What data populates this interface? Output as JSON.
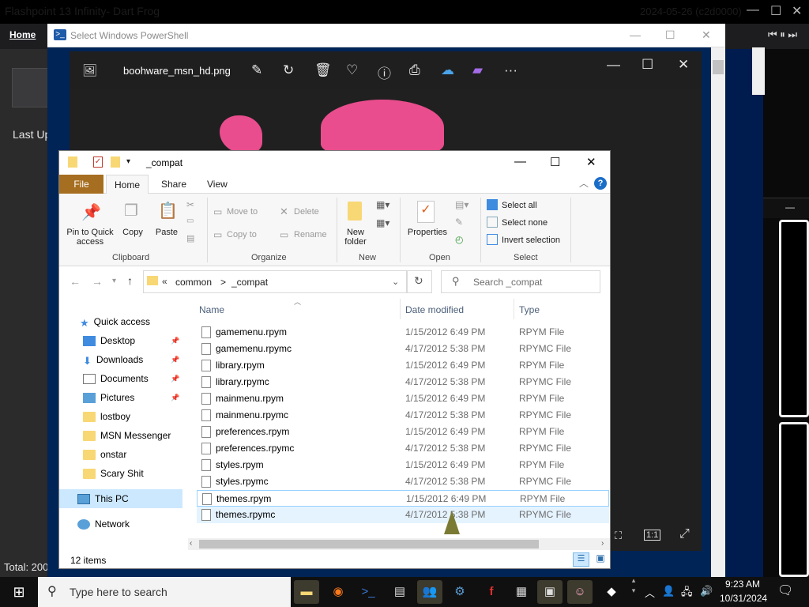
{
  "flashpoint": {
    "title": "Flashpoint 13 Infinity- Dart Frog",
    "date_build": "2024-05-26 (c2d0000)",
    "nav_home": "Home",
    "last_updated": "Last Up",
    "total": "Total: 200"
  },
  "powershell": {
    "title": "Select Windows PowerShell"
  },
  "photos": {
    "filename": "boohware_msn_hd.png",
    "zoom_label": "1:1"
  },
  "explorer": {
    "title": "_compat",
    "tabs": {
      "file": "File",
      "home": "Home",
      "share": "Share",
      "view": "View"
    },
    "ribbon": {
      "pin": "Pin to Quick access",
      "copy": "Copy",
      "paste": "Paste",
      "move_to": "Move to",
      "copy_to": "Copy to",
      "delete": "Delete",
      "rename": "Rename",
      "new_folder": "New folder",
      "properties": "Properties",
      "select_all": "Select all",
      "select_none": "Select none",
      "invert_selection": "Invert selection",
      "groups": {
        "clipboard": "Clipboard",
        "organize": "Organize",
        "new": "New",
        "open": "Open",
        "select": "Select"
      }
    },
    "address": {
      "crumb_prefix": "«",
      "crumb1": "common",
      "sep": ">",
      "crumb2": "_compat"
    },
    "search_placeholder": "Search _compat",
    "nav": {
      "quick_access": "Quick access",
      "desktop": "Desktop",
      "downloads": "Downloads",
      "documents": "Documents",
      "pictures": "Pictures",
      "lostboy": "lostboy",
      "msn": "MSN Messenger",
      "onstar": "onstar",
      "scary": "Scary Shit",
      "this_pc": "This PC",
      "network": "Network"
    },
    "columns": {
      "name": "Name",
      "date": "Date modified",
      "type": "Type"
    },
    "files": [
      {
        "name": "gamemenu.rpym",
        "date": "1/15/2012 6:49 PM",
        "type": "RPYM File"
      },
      {
        "name": "gamemenu.rpymc",
        "date": "4/17/2012 5:38 PM",
        "type": "RPYMC File"
      },
      {
        "name": "library.rpym",
        "date": "1/15/2012 6:49 PM",
        "type": "RPYM File"
      },
      {
        "name": "library.rpymc",
        "date": "4/17/2012 5:38 PM",
        "type": "RPYMC File"
      },
      {
        "name": "mainmenu.rpym",
        "date": "1/15/2012 6:49 PM",
        "type": "RPYM File"
      },
      {
        "name": "mainmenu.rpymc",
        "date": "4/17/2012 5:38 PM",
        "type": "RPYMC File"
      },
      {
        "name": "preferences.rpym",
        "date": "1/15/2012 6:49 PM",
        "type": "RPYM File"
      },
      {
        "name": "preferences.rpymc",
        "date": "4/17/2012 5:38 PM",
        "type": "RPYMC File"
      },
      {
        "name": "styles.rpym",
        "date": "1/15/2012 6:49 PM",
        "type": "RPYM File"
      },
      {
        "name": "styles.rpymc",
        "date": "4/17/2012 5:38 PM",
        "type": "RPYMC File"
      },
      {
        "name": "themes.rpym",
        "date": "1/15/2012 6:49 PM",
        "type": "RPYM File"
      },
      {
        "name": "themes.rpymc",
        "date": "4/17/2012 5:38 PM",
        "type": "RPYMC File"
      }
    ],
    "status": "12 items"
  },
  "taskbar": {
    "search_placeholder": "Type here to search",
    "time": "9:23 AM",
    "date": "10/31/2024"
  }
}
